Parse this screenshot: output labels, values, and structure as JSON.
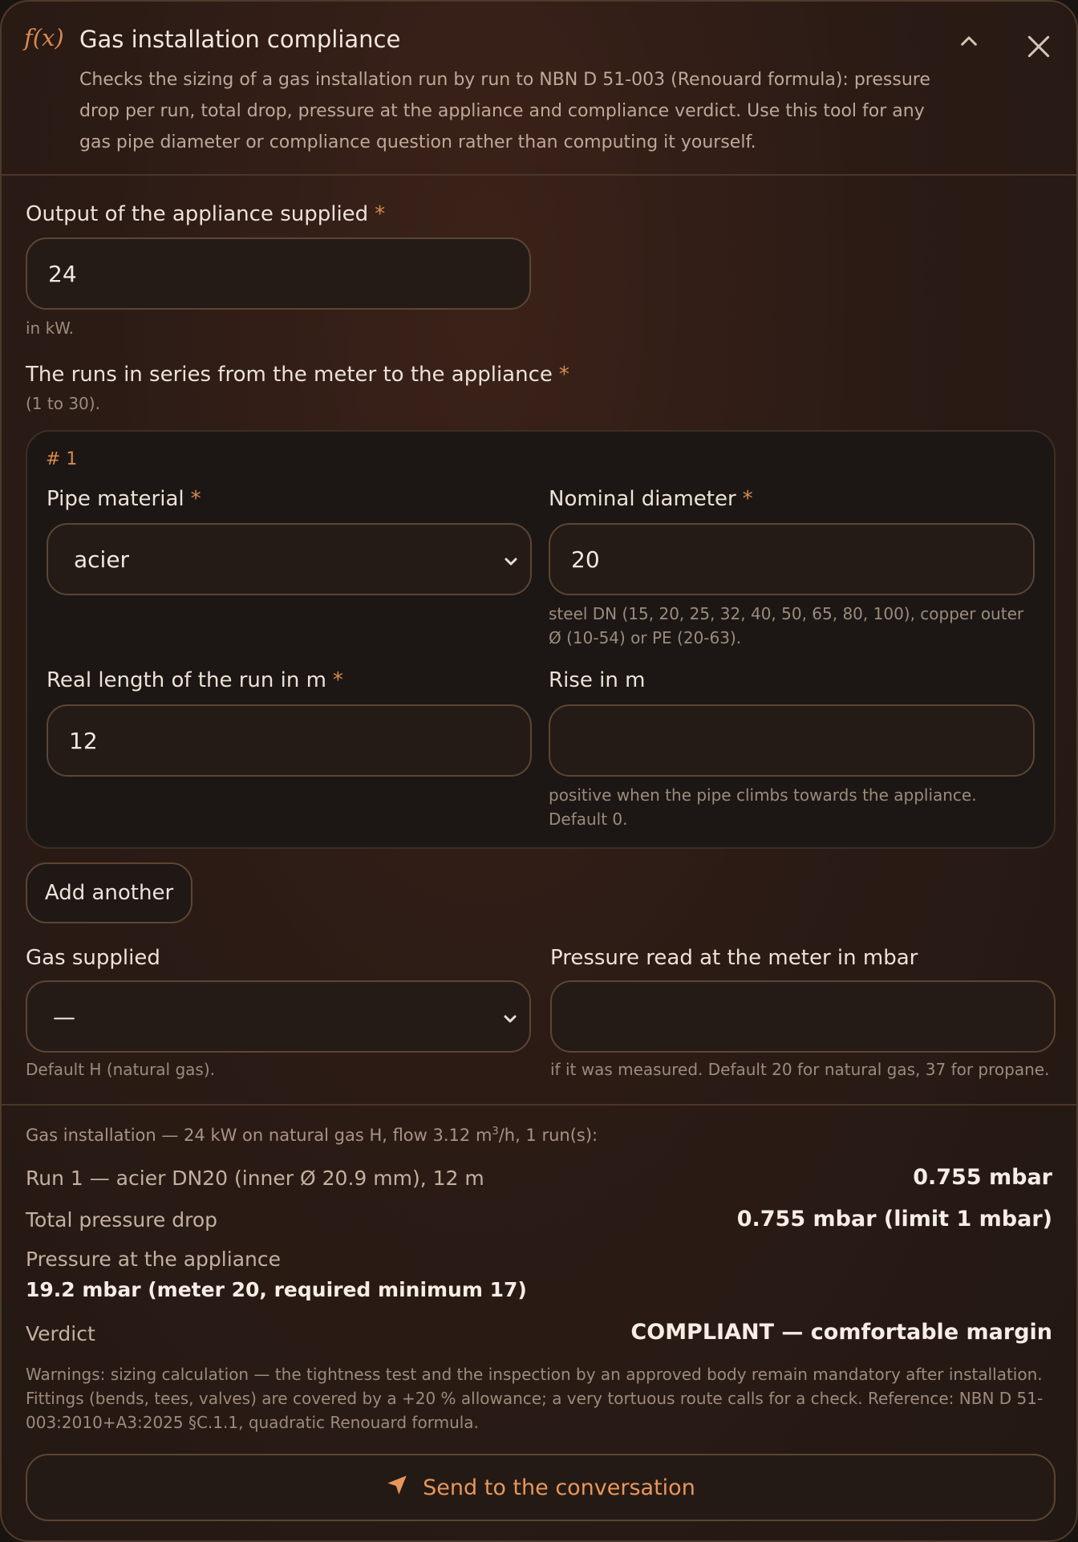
{
  "header": {
    "icon": "function-icon",
    "fx_label": "f(x)",
    "title": "Gas installation compliance",
    "description": "Checks the sizing of a gas installation run by run to NBN D 51-003 (Renouard formula): pressure drop per run, total drop, pressure at the appliance and compliance verdict. Use this tool for any gas pipe diameter or compliance question rather than computing it yourself."
  },
  "output_field": {
    "label": "Output of the appliance supplied",
    "required_mark": "*",
    "value": "24",
    "hint": "in kW."
  },
  "runs": {
    "label": "The runs in series from the meter to the appliance",
    "required_mark": "*",
    "hint": "(1 to 30).",
    "items": [
      {
        "number": "# 1",
        "material_label": "Pipe material",
        "material_value": "acier",
        "diameter_label": "Nominal diameter",
        "diameter_value": "20",
        "diameter_hint": "steel DN (15, 20, 25, 32, 40, 50, 65, 80, 100), copper outer Ø (10-54) or PE (20-63).",
        "length_label": "Real length of the run in m",
        "length_value": "12",
        "rise_label": "Rise in m",
        "rise_value": "",
        "rise_hint": "positive when the pipe climbs towards the appliance. Default 0."
      }
    ],
    "add_label": "Add another"
  },
  "gas": {
    "label": "Gas supplied",
    "value": "—",
    "hint": "Default H (natural gas)."
  },
  "pressure": {
    "label": "Pressure read at the meter in mbar",
    "value": "",
    "hint": "if it was measured. Default 20 for natural gas, 37 for propane."
  },
  "results": {
    "summary_pre": "Gas installation — 24 kW on natural gas H, flow 3.12 m",
    "summary_sup": "3",
    "summary_post": "/h, 1 run(s):",
    "run1_label": "Run 1 — acier DN20 (inner Ø 20.9 mm), 12 m",
    "run1_value": "0.755 mbar",
    "total_label": "Total pressure drop",
    "total_value": "0.755 mbar (limit 1 mbar)",
    "appliance_label": "Pressure at the appliance",
    "appliance_value": "19.2 mbar (meter 20, required minimum 17)",
    "verdict_label": "Verdict",
    "verdict_value": "COMPLIANT — comfortable margin",
    "warnings": "Warnings: sizing calculation — the tightness test and the inspection by an approved body remain mandatory after installation. Fittings (bends, tees, valves) are covered by a +20 % allowance; a very tortuous route calls for a check. Reference: NBN D 51-003:2010+A3:2025 §C.1.1, quadratic Renouard formula."
  },
  "send_label": "Send to the conversation",
  "colors": {
    "accent": "#d88a4e",
    "send_text": "#e8965a",
    "panel_bg": "#2c1b15"
  }
}
